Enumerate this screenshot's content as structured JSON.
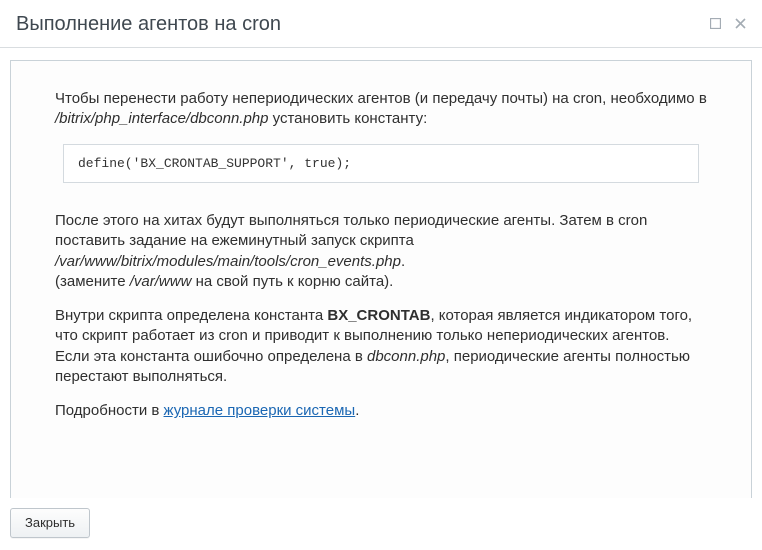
{
  "dialog": {
    "title": "Выполнение агентов на cron"
  },
  "icons": {
    "maximize": "maximize",
    "close": "close"
  },
  "content": {
    "intro_before_path": "Чтобы перенести работу непериодических агентов (и передачу почты) на cron, необходимо в ",
    "intro_path": "/bitrix/php_interface/dbconn.php",
    "intro_after_path": " установить константу:",
    "code": "define('BX_CRONTAB_SUPPORT', true);",
    "p2_before_path": "После этого на хитах будут выполняться только периодические агенты. Затем в cron поставить задание на ежеминутный запуск скрипта ",
    "p2_path": "/var/www/bitrix/modules/main/tools/cron_events.php",
    "p2_after_path": ".",
    "p2_line2_before": "(замените ",
    "p2_line2_path": "/var/www",
    "p2_line2_after": " на свой путь к корню сайта).",
    "p3_before_const": "Внутри скрипта определена константа ",
    "p3_const": "BX_CRONTAB",
    "p3_mid": ", которая является индикатором того, что скрипт работает из cron и приводит к выполнению только непериодических агентов. Если эта константа ошибочно определена в ",
    "p3_path": "dbconn.php",
    "p3_after": ", периодические агенты полностью перестают выполняться.",
    "details_before": "Подробности в ",
    "details_link": "журнале проверки системы",
    "details_after": "."
  },
  "footer": {
    "close_label": "Закрыть"
  }
}
